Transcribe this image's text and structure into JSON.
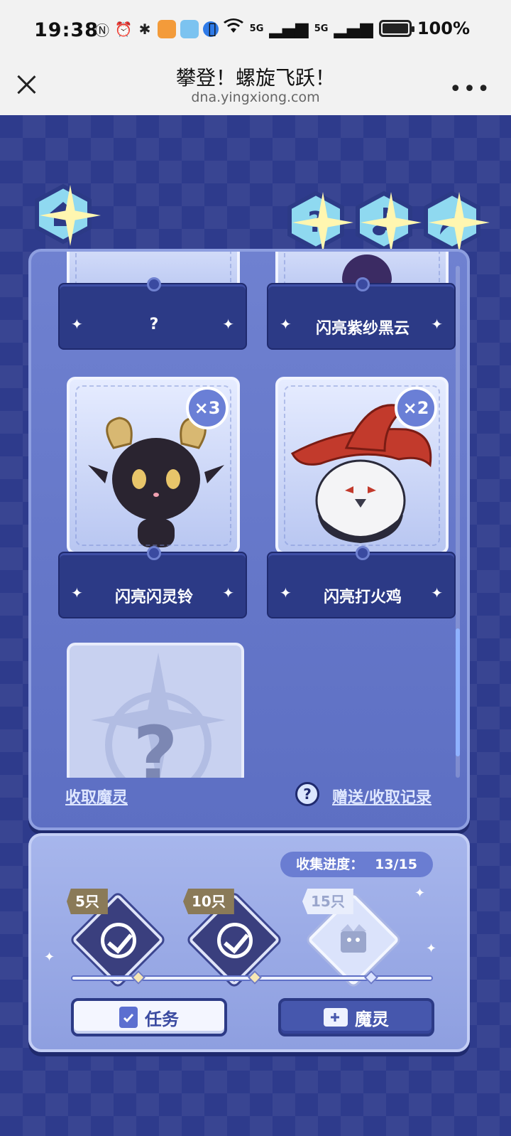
{
  "status_bar": {
    "time": "19:38",
    "icons": [
      "nfc-icon",
      "alarm-icon",
      "bluetooth-icon",
      "app-icon",
      "weather-icon",
      "browser-icon"
    ],
    "battery": "100%",
    "network": [
      "5G",
      "5G"
    ]
  },
  "browser": {
    "title": "攀登！螺旋飞跃！",
    "url": "dna.yingxiong.com",
    "close_icon": "close-icon",
    "more_icon": "more-icon"
  },
  "top_buttons": {
    "home": "home-icon",
    "help": "help-icon",
    "music": "music-icon",
    "share": "share-icon"
  },
  "cards": [
    {
      "name": "?",
      "count": ""
    },
    {
      "name": "闪亮紫纱黑云",
      "count": ""
    },
    {
      "name": "闪亮闪灵铃",
      "count": "×3"
    },
    {
      "name": "闪亮打火鸡",
      "count": "×2"
    },
    {
      "name": "?",
      "count": ""
    }
  ],
  "panel_footer": {
    "claim_link": "收取魔灵",
    "help_icon": "?",
    "records_link": "赠送/收取记录"
  },
  "progress": {
    "label": "收集进度：",
    "value": "13/15",
    "tiers": [
      {
        "tag": "5只",
        "claimed": true
      },
      {
        "tag": "10只",
        "claimed": true
      },
      {
        "tag": "15只",
        "claimed": false
      }
    ]
  },
  "buttons": {
    "task": "任务",
    "spirit": "魔灵"
  },
  "colors": {
    "background": "#2e3b8c",
    "panel": "#6f81d0",
    "accent": "#2c3a86"
  }
}
